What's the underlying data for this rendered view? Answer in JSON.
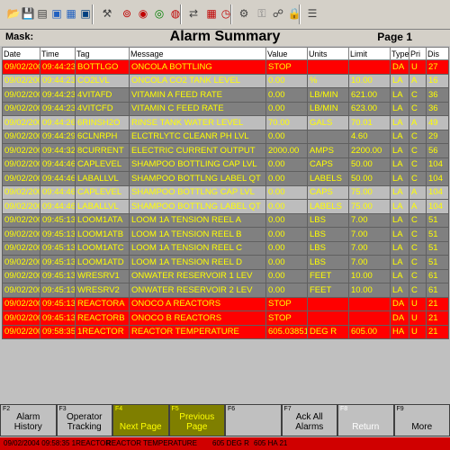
{
  "toolbar": {
    "icons": [
      {
        "name": "open-folder-icon",
        "glyph": "📂",
        "color": "#c08000"
      },
      {
        "name": "save-icon",
        "glyph": "💾",
        "color": "#3050c0"
      },
      {
        "name": "print-icon",
        "glyph": "▤",
        "color": "#404040"
      },
      {
        "name": "monitor-icon",
        "glyph": "▣",
        "color": "#2060c0"
      },
      {
        "name": "trend-icon",
        "glyph": "▦",
        "color": "#2060c0"
      },
      {
        "name": "display-icon",
        "glyph": "▣",
        "color": "#004080"
      },
      {
        "name": "wrench-icon",
        "glyph": "⚒",
        "color": "#404040"
      },
      {
        "name": "group-icon",
        "glyph": "⊚",
        "color": "#c00000"
      },
      {
        "name": "alarm-icon",
        "glyph": "◉",
        "color": "#c00000"
      },
      {
        "name": "process-icon",
        "glyph": "◎",
        "color": "#008000"
      },
      {
        "name": "target-icon",
        "glyph": "◍",
        "color": "#c00000"
      },
      {
        "name": "flow-icon",
        "glyph": "⇄",
        "color": "#404040"
      },
      {
        "name": "grid-icon",
        "glyph": "▦",
        "color": "#c00000"
      },
      {
        "name": "chart-icon",
        "glyph": "◷",
        "color": "#c00000"
      },
      {
        "name": "tools-icon",
        "glyph": "⚙",
        "color": "#404040"
      },
      {
        "name": "key-icon",
        "glyph": "⚿",
        "color": "#808080"
      },
      {
        "name": "signal-icon",
        "glyph": "☍",
        "color": "#404040"
      },
      {
        "name": "lock-icon",
        "glyph": "🔒",
        "color": "#c0a000"
      },
      {
        "name": "list-icon",
        "glyph": "☰",
        "color": "#404040"
      }
    ]
  },
  "header": {
    "mask_label": "Mask:",
    "title": "Alarm Summary",
    "page": "Page 1"
  },
  "columns": [
    "Date",
    "Time",
    "Tag",
    "Message",
    "Value",
    "Units",
    "Limit",
    "Type",
    "Pri",
    "Dis"
  ],
  "rows": [
    {
      "style": "red",
      "cells": [
        "09/02/2004",
        "09:44:23",
        "BOTTLGO",
        "ONCOLA   BOTTLING",
        "STOP",
        "",
        "",
        "DA",
        "U",
        "27"
      ]
    },
    {
      "style": "lgray",
      "cells": [
        "09/02/2004",
        "09:44:23",
        "CO2LVL",
        "ONCOLA   CO2 TANK LEVEL",
        "0.00",
        "%",
        "10.00",
        "LA",
        "A",
        "16"
      ]
    },
    {
      "style": "dgray",
      "cells": [
        "09/02/2004",
        "09:44:23",
        "4VITAFD",
        "VITAMIN A FEED RATE",
        "0.00",
        "LB/MIN",
        "621.00",
        "LA",
        "C",
        "36"
      ]
    },
    {
      "style": "dgray",
      "cells": [
        "09/02/2004",
        "09:44:23",
        "4VITCFD",
        "VITAMIN C FEED RATE",
        "0.00",
        "LB/MIN",
        "623.00",
        "LA",
        "C",
        "36"
      ]
    },
    {
      "style": "lgray",
      "cells": [
        "09/02/2004",
        "09:44:26",
        "6RINSH2O",
        "RINSE TANK WATER  LEVEL",
        "70.00",
        "GALS",
        "70.01",
        "LA",
        "A",
        "49"
      ]
    },
    {
      "style": "dgray",
      "cells": [
        "09/02/2004",
        "09:44:29",
        "6CLNRPH",
        "ELCTRLYTC CLEANR  PH LVL",
        "0.00",
        "",
        "4.60",
        "LA",
        "C",
        "29"
      ]
    },
    {
      "style": "dgray",
      "cells": [
        "09/02/2004",
        "09:44:32",
        "8CURRENT",
        "ELECTRIC CURRENT  OUTPUT",
        "2000.00",
        "AMPS",
        "2200.00",
        "LA",
        "C",
        "56"
      ]
    },
    {
      "style": "dgray",
      "cells": [
        "09/02/2004",
        "09:44:46",
        "CAPLEVEL",
        "SHAMPOO BOTTLING CAP LVL",
        "0.00",
        "CAPS",
        "50.00",
        "LA",
        "C",
        "104"
      ]
    },
    {
      "style": "dgray",
      "cells": [
        "09/02/2004",
        "09:44:46",
        "LABALLVL",
        "SHAMPOO BOTTLNG LABEL QT",
        "0.00",
        "LABELS",
        "50.00",
        "LA",
        "C",
        "104"
      ]
    },
    {
      "style": "lgray",
      "cells": [
        "09/02/2004",
        "09:44:46",
        "CAPLEVEL",
        "SHAMPOO BOTTLNG CAP LVL",
        "0.00",
        "CAPS",
        "75.00",
        "LA",
        "A",
        "104"
      ]
    },
    {
      "style": "lgray",
      "cells": [
        "09/02/2004",
        "09:44:46",
        "LABALLVL",
        "SHAMPOO BOTTLNG LABEL QT",
        "0.00",
        "LABELS",
        "75.00",
        "LA",
        "A",
        "104"
      ]
    },
    {
      "style": "dgray",
      "cells": [
        "09/02/2004",
        "09:45:13",
        "LOOM1ATA",
        "LOOM 1A  TENSION REEL A",
        "0.00",
        "LBS",
        "7.00",
        "LA",
        "C",
        "51"
      ]
    },
    {
      "style": "dgray",
      "cells": [
        "09/02/2004",
        "09:45:13",
        "LOOM1ATB",
        "LOOM 1A  TENSION REEL B",
        "0.00",
        "LBS",
        "7.00",
        "LA",
        "C",
        "51"
      ]
    },
    {
      "style": "dgray",
      "cells": [
        "09/02/2004",
        "09:45:13",
        "LOOM1ATC",
        "LOOM 1A  TENSION REEL C",
        "0.00",
        "LBS",
        "7.00",
        "LA",
        "C",
        "51"
      ]
    },
    {
      "style": "dgray",
      "cells": [
        "09/02/2004",
        "09:45:13",
        "LOOM1ATD",
        "LOOM 1A  TENSION REEL D",
        "0.00",
        "LBS",
        "7.00",
        "LA",
        "C",
        "51"
      ]
    },
    {
      "style": "dgray",
      "cells": [
        "09/02/2004",
        "09:45:13",
        "WRESRV1",
        "ONWATER RESERVOIR 1 LEV",
        "0.00",
        "FEET",
        "10.00",
        "LA",
        "C",
        "61"
      ]
    },
    {
      "style": "dgray",
      "cells": [
        "09/02/2004",
        "09:45:13",
        "WRESRV2",
        "ONWATER RESERVOIR 2 LEV",
        "0.00",
        "FEET",
        "10.00",
        "LA",
        "C",
        "61"
      ]
    },
    {
      "style": "red",
      "cells": [
        "09/02/2004",
        "09:45:13",
        "REACTORA",
        "ONOCO A  REACTORS",
        "STOP",
        "",
        "",
        "DA",
        "U",
        "21"
      ]
    },
    {
      "style": "red",
      "cells": [
        "09/02/2004",
        "09:45:13",
        "REACTORB",
        "ONOCO B  REACTORS",
        "STOP",
        "",
        "",
        "DA",
        "U",
        "21"
      ]
    },
    {
      "style": "red",
      "cells": [
        "09/02/2004",
        "09:58:35",
        "1REACTOR",
        "REACTOR  TEMPERATURE",
        "605.038511",
        "DEG R",
        "605.00",
        "HA",
        "U",
        "21"
      ]
    }
  ],
  "fkeys": [
    {
      "num": "F2",
      "label": "Alarm History",
      "style": "normal",
      "name": "alarm-history-button"
    },
    {
      "num": "F3",
      "label": "Operator Tracking",
      "style": "normal",
      "name": "operator-tracking-button"
    },
    {
      "num": "F4",
      "label": "Next Page",
      "style": "green",
      "name": "next-page-button"
    },
    {
      "num": "F5",
      "label": "Previous Page",
      "style": "green",
      "name": "previous-page-button"
    },
    {
      "num": "F6",
      "label": "",
      "style": "normal",
      "name": "f6-button"
    },
    {
      "num": "F7",
      "label": "Ack All Alarms",
      "style": "normal",
      "name": "ack-all-alarms-button"
    },
    {
      "num": "F8",
      "label": "Return",
      "style": "dim",
      "name": "return-button"
    },
    {
      "num": "F9",
      "label": "More",
      "style": "normal",
      "name": "more-button"
    }
  ],
  "status": {
    "datetime": "09/02/2004 09:58:35 1REACTOR",
    "message": "REACTOR  TEMPERATURE",
    "value": "605 DEG R",
    "limit": "605 HA 21"
  },
  "colors": {
    "alarm_red": "#ff0000",
    "text_yellow": "#ffff00",
    "light_gray": "#bdbdbd",
    "dark_gray": "#808080",
    "fkey_green": "#7f7f00"
  }
}
